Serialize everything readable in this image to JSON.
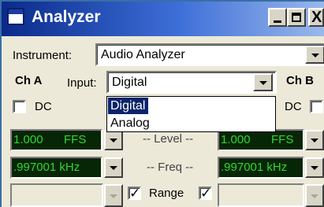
{
  "window": {
    "title": "Analyzer"
  },
  "caption_buttons": {
    "minimize": "_",
    "maximize": "□",
    "close": "X"
  },
  "instrument": {
    "label": "Instrument:",
    "value": "Audio Analyzer"
  },
  "channel_a": {
    "label": "Ch A",
    "dc_label": "DC",
    "dc_checked": false,
    "level": {
      "value": "1.000",
      "unit": "FFS"
    },
    "freq": {
      "value": ".997001 kHz"
    },
    "range_checked": true
  },
  "channel_b": {
    "label": "Ch B",
    "dc_label": "DC",
    "dc_checked": false,
    "level": {
      "value": "1.000",
      "unit": "FFS"
    },
    "freq": {
      "value": ".997001 kHz"
    },
    "range_checked": true
  },
  "input": {
    "label": "Input:",
    "value": "Digital",
    "options": [
      "Digital",
      "Analog"
    ],
    "selected_option": "Digital"
  },
  "center_labels": {
    "level": "-- Level --",
    "freq": "-- Freq --",
    "range": "Range"
  },
  "checkmark": "✓"
}
